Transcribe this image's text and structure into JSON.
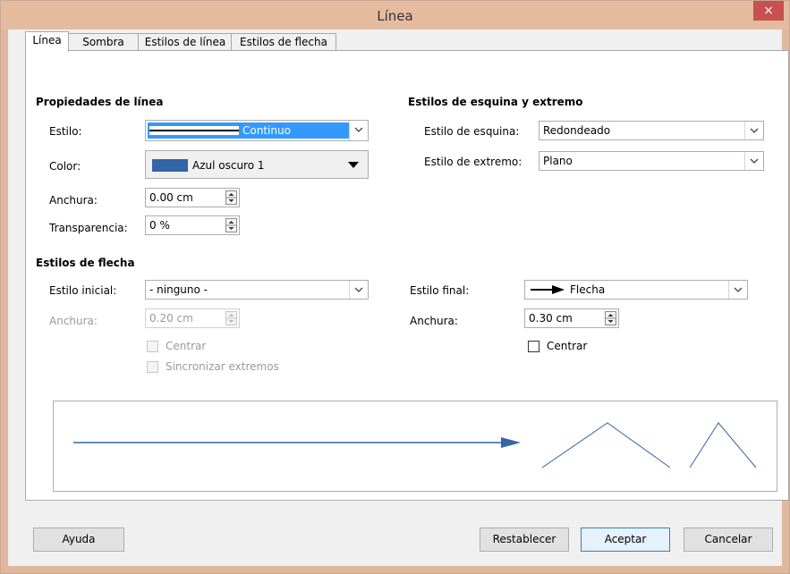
{
  "window": {
    "title": "Línea",
    "close": "×"
  },
  "tabs": [
    "Línea",
    "Sombra",
    "Estilos de línea",
    "Estilos de flecha"
  ],
  "line_props": {
    "header": "Propiedades de línea",
    "style_label": "Estilo:",
    "style_value": "Continuo",
    "color_label": "Color:",
    "color_value": "Azul oscuro 1",
    "color_hex": "#3465a4",
    "width_label": "Anchura:",
    "width_value": "0.00 cm",
    "transparency_label": "Transparencia:",
    "transparency_value": "0 %"
  },
  "corner": {
    "header": "Estilos de esquina y extremo",
    "corner_label": "Estilo de esquina:",
    "corner_value": "Redondeado",
    "cap_label": "Estilo de extremo:",
    "cap_value": "Plano"
  },
  "arrows": {
    "header": "Estilos de flecha",
    "start_label": "Estilo inicial:",
    "start_value": "- ninguno -",
    "start_width_label": "Anchura:",
    "start_width_value": "0.20 cm",
    "center_label": "Centrar",
    "sync_label": "Sincronizar extremos",
    "end_label": "Estilo final:",
    "end_value": "Flecha",
    "end_width_label": "Anchura:",
    "end_width_value": "0.30 cm",
    "end_center_label": "Centrar"
  },
  "buttons": {
    "help": "Ayuda",
    "reset": "Restablecer",
    "ok": "Aceptar",
    "cancel": "Cancelar"
  }
}
